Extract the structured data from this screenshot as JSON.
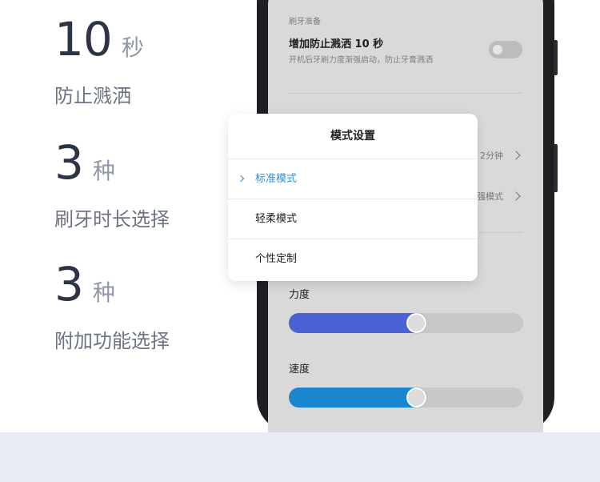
{
  "features": [
    {
      "number": "10",
      "unit": "秒",
      "desc": "防止溅洒"
    },
    {
      "number": "3",
      "unit": "种",
      "desc": "刷牙时长选择"
    },
    {
      "number": "3",
      "unit": "种",
      "desc": "附加功能选择"
    }
  ],
  "screen": {
    "section_label": "刷牙准备",
    "splash_setting": {
      "title": "增加防止溅洒 10 秒",
      "subtitle": "开机后牙刷力度渐强启动，防止牙膏溅洒",
      "enabled": false
    },
    "duration_value": "2分钟",
    "mode_value": "强模式",
    "strength": {
      "label": "力度",
      "level": 0.55,
      "color": "#4a62d4"
    },
    "speed": {
      "label": "速度",
      "level": 0.55,
      "color": "#1a86d0"
    }
  },
  "modal": {
    "title": "模式设置",
    "options": [
      {
        "label": "标准模式",
        "selected": true
      },
      {
        "label": "轻柔模式",
        "selected": false
      },
      {
        "label": "个性定制",
        "selected": false
      }
    ]
  },
  "colors": {
    "accent": "#2a92d8",
    "dark_text": "#2d3446",
    "band": "#e7ebf4"
  }
}
